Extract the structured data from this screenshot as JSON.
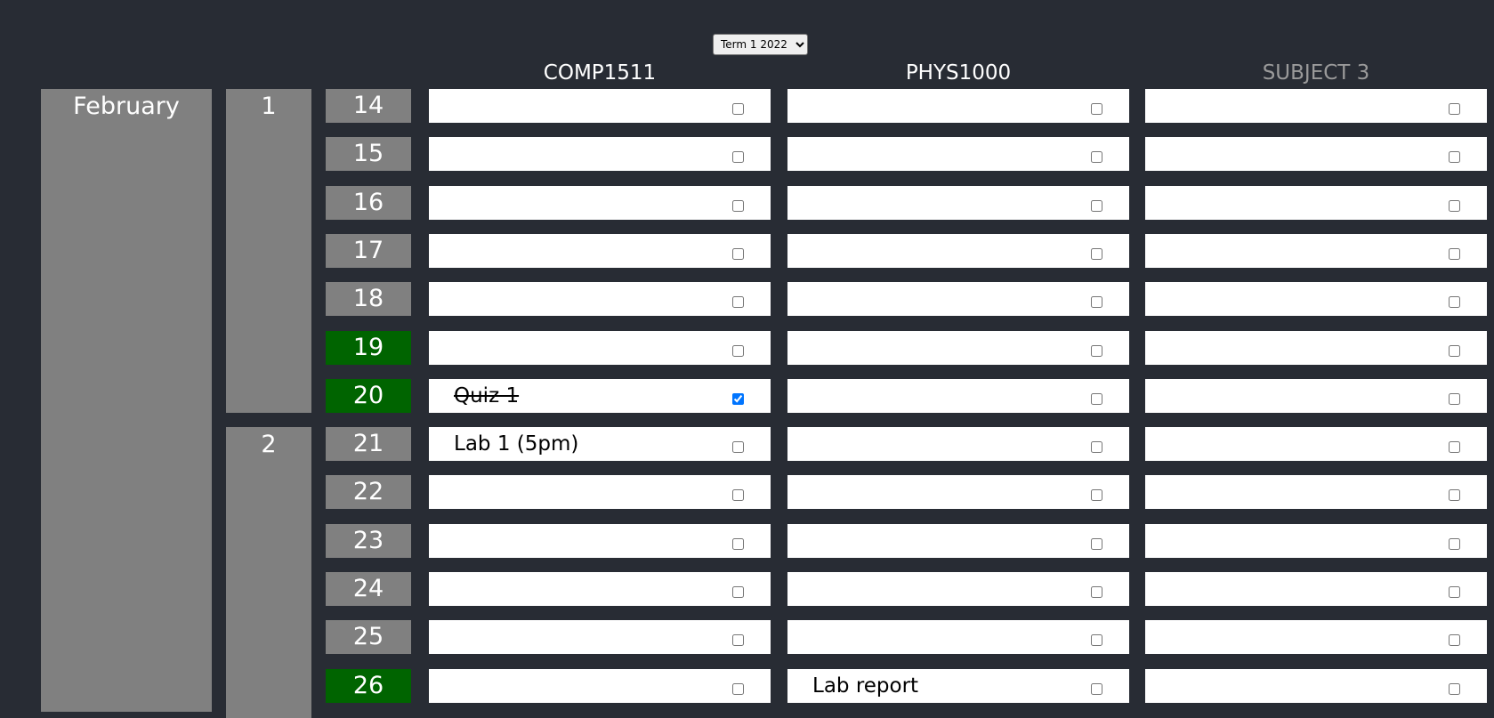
{
  "term_select": {
    "selected": "Term 1 2022"
  },
  "subjects": [
    {
      "name": "COMP1511",
      "muted": false
    },
    {
      "name": "PHYS1000",
      "muted": false
    },
    {
      "name": "SUBJECT 3",
      "muted": true
    }
  ],
  "month": "February",
  "weeks": [
    {
      "label": "1",
      "days": [
        "14",
        "15",
        "16",
        "17",
        "18",
        "19",
        "20"
      ]
    },
    {
      "label": "2",
      "days": [
        "21",
        "22",
        "23",
        "24",
        "25",
        "26"
      ]
    }
  ],
  "colors": {
    "background": "#282c34",
    "block_grey": "#808080",
    "current_day_green": "#006400",
    "cell_white": "#ffffff",
    "muted_header": "#9a9a9a"
  },
  "rows": [
    {
      "day": "14",
      "highlight": false,
      "tasks": [
        {
          "text": "",
          "done": false
        },
        {
          "text": "",
          "done": false
        },
        {
          "text": "",
          "done": false
        }
      ]
    },
    {
      "day": "15",
      "highlight": false,
      "tasks": [
        {
          "text": "",
          "done": false
        },
        {
          "text": "",
          "done": false
        },
        {
          "text": "",
          "done": false
        }
      ]
    },
    {
      "day": "16",
      "highlight": false,
      "tasks": [
        {
          "text": "",
          "done": false
        },
        {
          "text": "",
          "done": false
        },
        {
          "text": "",
          "done": false
        }
      ]
    },
    {
      "day": "17",
      "highlight": false,
      "tasks": [
        {
          "text": "",
          "done": false
        },
        {
          "text": "",
          "done": false
        },
        {
          "text": "",
          "done": false
        }
      ]
    },
    {
      "day": "18",
      "highlight": false,
      "tasks": [
        {
          "text": "",
          "done": false
        },
        {
          "text": "",
          "done": false
        },
        {
          "text": "",
          "done": false
        }
      ]
    },
    {
      "day": "19",
      "highlight": true,
      "tasks": [
        {
          "text": "",
          "done": false
        },
        {
          "text": "",
          "done": false
        },
        {
          "text": "",
          "done": false
        }
      ]
    },
    {
      "day": "20",
      "highlight": true,
      "tasks": [
        {
          "text": "Quiz 1",
          "done": true
        },
        {
          "text": "",
          "done": false
        },
        {
          "text": "",
          "done": false
        }
      ]
    },
    {
      "day": "21",
      "highlight": false,
      "tasks": [
        {
          "text": "Lab 1 (5pm)",
          "done": false
        },
        {
          "text": "",
          "done": false
        },
        {
          "text": "",
          "done": false
        }
      ]
    },
    {
      "day": "22",
      "highlight": false,
      "tasks": [
        {
          "text": "",
          "done": false
        },
        {
          "text": "",
          "done": false
        },
        {
          "text": "",
          "done": false
        }
      ]
    },
    {
      "day": "23",
      "highlight": false,
      "tasks": [
        {
          "text": "",
          "done": false
        },
        {
          "text": "",
          "done": false
        },
        {
          "text": "",
          "done": false
        }
      ]
    },
    {
      "day": "24",
      "highlight": false,
      "tasks": [
        {
          "text": "",
          "done": false
        },
        {
          "text": "",
          "done": false
        },
        {
          "text": "",
          "done": false
        }
      ]
    },
    {
      "day": "25",
      "highlight": false,
      "tasks": [
        {
          "text": "",
          "done": false
        },
        {
          "text": "",
          "done": false
        },
        {
          "text": "",
          "done": false
        }
      ]
    },
    {
      "day": "26",
      "highlight": true,
      "tasks": [
        {
          "text": "",
          "done": false
        },
        {
          "text": "Lab report",
          "done": false
        },
        {
          "text": "",
          "done": false
        }
      ]
    }
  ]
}
